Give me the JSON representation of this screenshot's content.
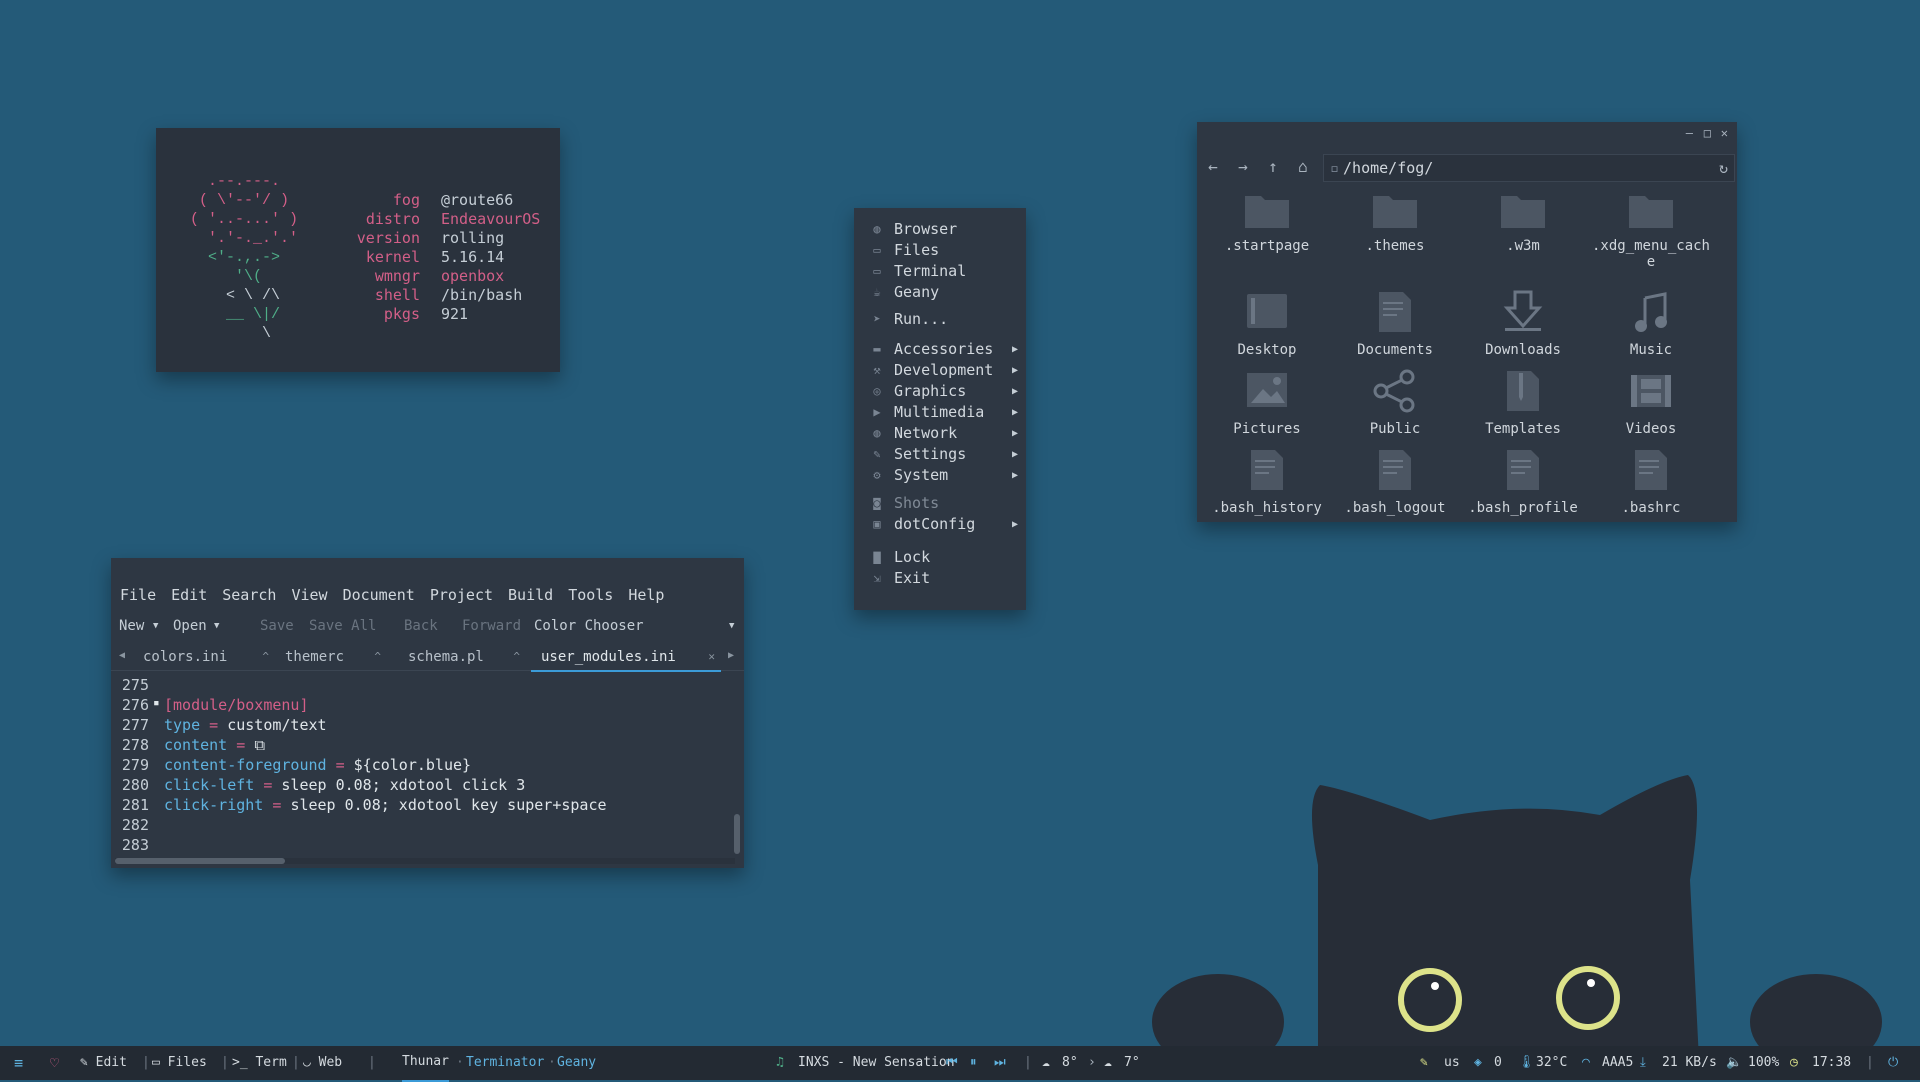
{
  "fetch": {
    "ascii_lines": [
      {
        "t": "  .--.---.",
        "c": "pink"
      },
      {
        "t": " ( \\'--'/ )",
        "c": "pink"
      },
      {
        "t": "( '..-...' )",
        "c": "pink"
      },
      {
        "t": "  '.'-._.'.'",
        "c": "pink"
      },
      {
        "t": "  <'-.,.->",
        "c": "green"
      },
      {
        "t": "     '\\(",
        "c": "green"
      },
      {
        "t": "    < \\ /\\",
        "c": "white"
      },
      {
        "t": "    __ \\|/",
        "c": "green"
      },
      {
        "t": "        \\",
        "c": "white"
      }
    ],
    "rows": [
      {
        "key": "fog",
        "val": "@route66",
        "valColor": "white"
      },
      {
        "key": "distro",
        "val": "EndeavourOS",
        "valColor": "pink"
      },
      {
        "key": "version",
        "val": "rolling",
        "valColor": "white"
      },
      {
        "key": "kernel",
        "val": "5.16.14",
        "valColor": "white"
      },
      {
        "key": "wmngr",
        "val": "openbox",
        "valColor": "pink"
      },
      {
        "key": "shell",
        "val": "/bin/bash",
        "valColor": "white"
      },
      {
        "key": "pkgs",
        "val": "921",
        "valColor": "white"
      }
    ]
  },
  "menu": {
    "items": [
      {
        "label": "Browser",
        "icon": "globe-icon",
        "sub": false
      },
      {
        "label": "Files",
        "icon": "folder-icon",
        "sub": false
      },
      {
        "label": "Terminal",
        "icon": "terminal-icon",
        "sub": false
      },
      {
        "label": "Geany",
        "icon": "geany-icon",
        "sub": false
      },
      {
        "label": "Run...",
        "icon": "run-icon",
        "sub": false
      },
      {
        "label": "Accessories",
        "icon": "accessories-icon",
        "sub": true
      },
      {
        "label": "Development",
        "icon": "development-icon",
        "sub": true
      },
      {
        "label": "Graphics",
        "icon": "graphics-icon",
        "sub": true
      },
      {
        "label": "Multimedia",
        "icon": "multimedia-icon",
        "sub": true
      },
      {
        "label": "Network",
        "icon": "network-icon",
        "sub": true
      },
      {
        "label": "Settings",
        "icon": "settings-icon",
        "sub": true
      },
      {
        "label": "System",
        "icon": "system-icon",
        "sub": true
      },
      {
        "label": "Shots",
        "icon": "camera-icon",
        "sub": false,
        "dim": true
      },
      {
        "label": "dotConfig",
        "icon": "config-icon",
        "sub": true
      },
      {
        "label": "Lock",
        "icon": "lock-icon",
        "sub": false
      },
      {
        "label": "Exit",
        "icon": "exit-icon",
        "sub": false
      }
    ]
  },
  "filemanager": {
    "path": "/home/fog/",
    "items": [
      {
        "label": ".startpage",
        "icon": "folder-icon"
      },
      {
        "label": ".themes",
        "icon": "folder-icon"
      },
      {
        "label": ".w3m",
        "icon": "folder-icon"
      },
      {
        "label": ".xdg_menu_cach",
        "label2": "e",
        "icon": "folder-icon"
      },
      {
        "label": "Desktop",
        "icon": "desktop-folder-icon"
      },
      {
        "label": "Documents",
        "icon": "documents-folder-icon"
      },
      {
        "label": "Downloads",
        "icon": "downloads-folder-icon"
      },
      {
        "label": "Music",
        "icon": "music-folder-icon"
      },
      {
        "label": "Pictures",
        "icon": "pictures-folder-icon"
      },
      {
        "label": "Public",
        "icon": "public-folder-icon"
      },
      {
        "label": "Templates",
        "icon": "templates-folder-icon"
      },
      {
        "label": "Videos",
        "icon": "videos-folder-icon"
      },
      {
        "label": ".bash_history",
        "icon": "text-file-icon"
      },
      {
        "label": ".bash_logout",
        "icon": "text-file-icon"
      },
      {
        "label": ".bash_profile",
        "icon": "text-file-icon"
      },
      {
        "label": ".bashrc",
        "icon": "text-file-icon"
      }
    ]
  },
  "editor": {
    "menubar": [
      "File",
      "Edit",
      "Search",
      "View",
      "Document",
      "Project",
      "Build",
      "Tools",
      "Help"
    ],
    "toolbar": {
      "new": "New",
      "open": "Open",
      "save": "Save",
      "save_all": "Save All",
      "back": "Back",
      "forward": "Forward",
      "color_chooser": "Color Chooser"
    },
    "tabs": [
      "colors.ini",
      "themerc",
      "schema.pl",
      "user_modules.ini"
    ],
    "lines": [
      {
        "n": "275",
        "parts": []
      },
      {
        "n": "276",
        "parts": [
          {
            "t": "[module/boxmenu]",
            "c": "pink"
          }
        ]
      },
      {
        "n": "277",
        "parts": [
          {
            "t": "type",
            "c": "blue"
          },
          {
            "t": " = ",
            "c": "pink"
          },
          {
            "t": "custom/text",
            "c": "white"
          }
        ]
      },
      {
        "n": "278",
        "parts": [
          {
            "t": "content",
            "c": "blue"
          },
          {
            "t": " = ",
            "c": "pink"
          },
          {
            "t": "⧉",
            "c": "white"
          }
        ]
      },
      {
        "n": "279",
        "parts": [
          {
            "t": "content-foreground",
            "c": "blue"
          },
          {
            "t": " = ",
            "c": "pink"
          },
          {
            "t": "${color.blue}",
            "c": "white"
          }
        ]
      },
      {
        "n": "280",
        "parts": [
          {
            "t": "click-left",
            "c": "blue"
          },
          {
            "t": " = ",
            "c": "pink"
          },
          {
            "t": "sleep 0.08; xdotool click 3",
            "c": "white"
          }
        ]
      },
      {
        "n": "281",
        "parts": [
          {
            "t": "click-right",
            "c": "blue"
          },
          {
            "t": " = ",
            "c": "pink"
          },
          {
            "t": "sleep 0.08; xdotool key super+space",
            "c": "white"
          }
        ]
      },
      {
        "n": "282",
        "parts": []
      },
      {
        "n": "283",
        "parts": []
      }
    ]
  },
  "taskbar": {
    "edit": "Edit",
    "files": "Files",
    "term": "Term",
    "web": "Web",
    "tasks": [
      "Thunar",
      "Terminator",
      "Geany"
    ],
    "music": "INXS - New Sensation",
    "weather1": "8°",
    "weather2": "7°",
    "kb": "us",
    "updates": "0",
    "temp": "32°C",
    "wifi": "AAA5",
    "net": "21 KB/s",
    "volume": "100%",
    "time": "17:38"
  },
  "colors": {
    "desktop": "#245a78",
    "panel": "#2e3743",
    "accent_blue": "#5fb3e0",
    "accent_pink": "#d35f88",
    "accent_green": "#4fae88",
    "cat": "#272d37",
    "cat_eye": "#dde38a"
  }
}
